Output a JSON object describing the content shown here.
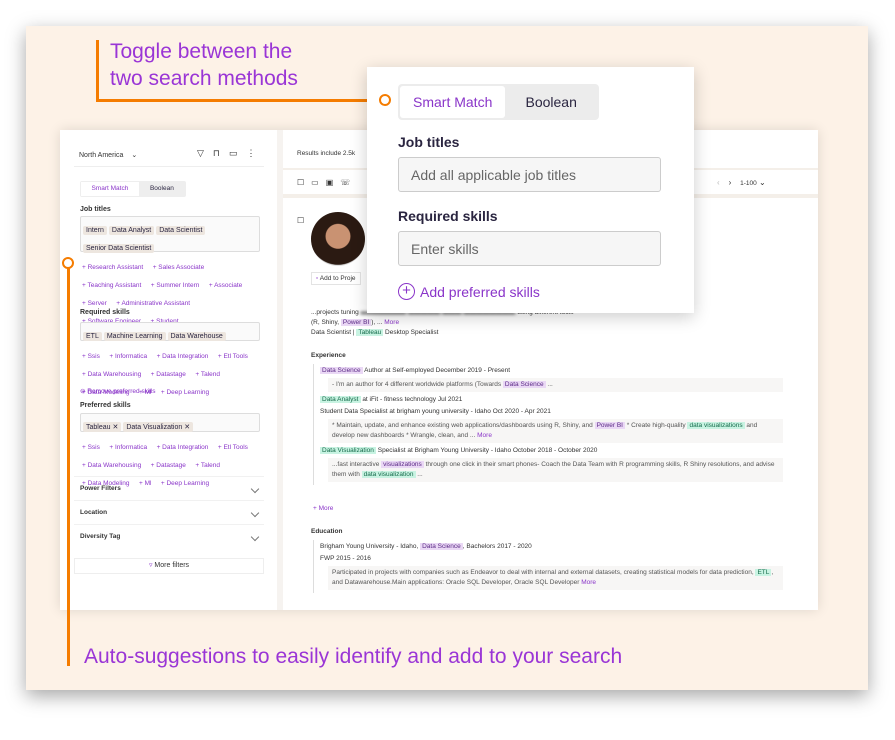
{
  "annotations": {
    "top": "Toggle between the two search methods",
    "top_line1": "Toggle between the",
    "top_line2": "two search methods",
    "bottom": "Auto-suggestions to easily identify and add to your search"
  },
  "colors": {
    "accent": "#9a35d6",
    "annotation": "#f57c00",
    "background": "#fdf2e7"
  },
  "sidebar": {
    "region": "North America",
    "tabs": [
      "Smart Match",
      "Boolean"
    ],
    "job_titles_label": "Job titles",
    "job_titles": [
      "Intern",
      "Data Analyst",
      "Data Scientist",
      "Senior Data Scientist"
    ],
    "job_suggestions": [
      "+ Research Assistant",
      "+ Sales Associate",
      "+ Teaching Assistant",
      "+ Summer Intern",
      "+ Associate",
      "+ Server",
      "+ Administrative Assistant",
      "+ Software Engineer",
      "+ Student"
    ],
    "required_label": "Required skills",
    "required": [
      "ETL",
      "Machine Learning",
      "Data Warehouse"
    ],
    "skill_suggestions": [
      "+ Ssis",
      "+ Informatica",
      "+ Data Integration",
      "+ Etl Tools",
      "+ Data Warehousing",
      "+ Datastage",
      "+ Talend",
      "+ Data Modeling",
      "+ Ml",
      "+ Deep Learning"
    ],
    "remove_preferred": "Remove preferred skills",
    "preferred_label": "Preferred skills",
    "preferred": [
      "Tableau",
      "Data Visualization"
    ],
    "filters": [
      "Power Filters",
      "Location",
      "Diversity Tag"
    ],
    "more_filters": "More filters"
  },
  "main": {
    "results": "Results include 2.5k",
    "pagination": "1-100",
    "add_to_project": "Add to Proje",
    "summary1": "...projects tuning",
    "summary1b": "using different tools",
    "summary2a": "(R, Shiny,",
    "summary2b": "Power BI",
    "summary2c": "), ...",
    "more": "More",
    "title_a": "Data Scientist |",
    "title_b": "Tableau",
    "title_c": "Desktop Specialist",
    "experience_label": "Experience",
    "education_label": "Education",
    "more_link": "+ More",
    "experience": [
      {
        "hl": "Data Science",
        "hlc": "p",
        "rest": "Author at Self-employed December 2019 - Present",
        "desc": [
          "- I'm an author for 4 different worldwide platforms (Towards ",
          {
            "p": "Data Science"
          },
          " ..."
        ]
      },
      {
        "hl": "Data Analyst",
        "hlc": "g",
        "rest": "at iFit - fitness technology Jul 2021"
      },
      {
        "hl": "",
        "rest": "Student Data Specialist at brigham young university - Idaho Oct 2020 - Apr 2021",
        "desc": [
          "* Maintain, update, and enhance existing web applications/dashboards using R, Shiny, and ",
          {
            "p": "Power BI"
          },
          " * Create high-quality ",
          {
            "g": "data visualizations"
          },
          " and develop new dashboards * Wrangle, clean, and ... ",
          {
            "m": "More"
          }
        ]
      },
      {
        "hl": "Data Visualization",
        "hlc": "g",
        "rest": "Specialist at Brigham Young University - Idaho October 2018 - October 2020",
        "desc": [
          "...fast interactive ",
          {
            "p": "visualizations"
          },
          " through one click in their smart phones- Coach the Data Team with R programming skills, R Shiny resolutions, and advise them with ",
          {
            "g": "data visualization"
          },
          " ..."
        ]
      }
    ],
    "education": [
      {
        "pre": "Brigham Young University - Idaho, ",
        "hl": "Data Science",
        "post": ", Bachelors 2017 - 2020"
      },
      {
        "pre": "FWP 2015 - 2016",
        "desc": [
          "Participated in projects with companies such as Endeavor to deal with internal and external datasets, creating statistical models for data prediction, ",
          {
            "g": "ETL"
          },
          ", and Datawarehouse.Main applications: Oracle SQL Developer, Oracle SQL Developer ",
          {
            "m": "More"
          }
        ]
      }
    ]
  },
  "popup": {
    "tabs": [
      "Smart Match",
      "Boolean"
    ],
    "job_titles_label": "Job titles",
    "job_titles_placeholder": "Add all applicable job titles",
    "required_label": "Required skills",
    "skills_placeholder": "Enter skills",
    "add_preferred": "Add preferred skills"
  }
}
